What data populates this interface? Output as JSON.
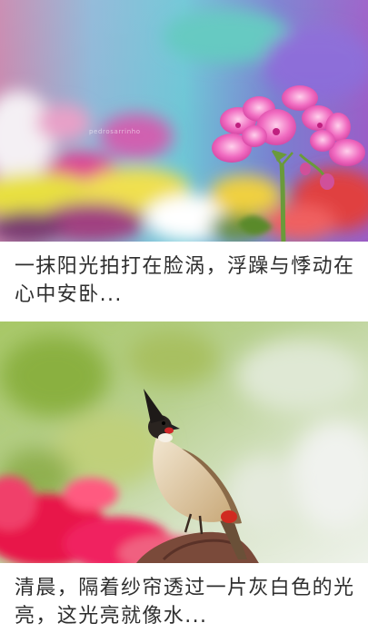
{
  "feed": {
    "items": [
      {
        "photo_alt": "pink-flower",
        "watermark": "pedrosarrinho",
        "caption": "一抹阳光拍打在脸涡，浮躁与悸动在心中安卧..."
      },
      {
        "photo_alt": "bird-on-branch",
        "caption": "清晨，隔着纱帘透过一片灰白色的光亮，这光亮就像水..."
      }
    ]
  }
}
